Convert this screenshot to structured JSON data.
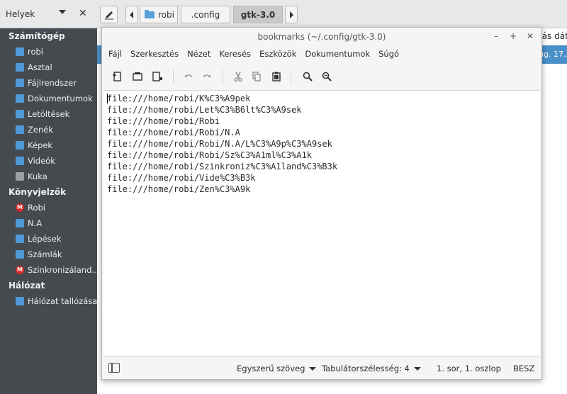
{
  "file_manager": {
    "places_header": {
      "title": "Helyek"
    },
    "breadcrumbs": [
      {
        "label": "robi"
      },
      {
        "label": ".config"
      },
      {
        "label": "gtk-3.0"
      }
    ],
    "column_header_fragment": "tás dát",
    "selected_row_date_fragment": "ug. 17.,",
    "sidebar": {
      "sections": [
        {
          "title": "Számítógép",
          "items": [
            {
              "label": "robi",
              "icon": "home-folder-icon"
            },
            {
              "label": "Asztal",
              "icon": "desktop-folder-icon"
            },
            {
              "label": "Fájlrendszer",
              "icon": "filesystem-icon"
            },
            {
              "label": "Dokumentumok",
              "icon": "documents-folder-icon"
            },
            {
              "label": "Letöltések",
              "icon": "downloads-folder-icon"
            },
            {
              "label": "Zenék",
              "icon": "music-folder-icon"
            },
            {
              "label": "Képek",
              "icon": "pictures-folder-icon"
            },
            {
              "label": "Videók",
              "icon": "videos-folder-icon"
            },
            {
              "label": "Kuka",
              "icon": "trash-icon"
            }
          ]
        },
        {
          "title": "Könyvjelzők",
          "items": [
            {
              "label": "Robi",
              "icon": "mega-icon"
            },
            {
              "label": "N.A",
              "icon": "folder-icon"
            },
            {
              "label": "Lépések",
              "icon": "folder-icon"
            },
            {
              "label": "Számlák",
              "icon": "folder-icon"
            },
            {
              "label": "Szinkronizáland…",
              "icon": "mega-icon"
            }
          ]
        },
        {
          "title": "Hálózat",
          "items": [
            {
              "label": "Hálózat tallózása",
              "icon": "network-icon"
            }
          ]
        }
      ]
    }
  },
  "gedit": {
    "title": "bookmarks (~/.config/gtk-3.0)",
    "menu": [
      "Fájl",
      "Szerkesztés",
      "Nézet",
      "Keresés",
      "Eszközök",
      "Dokumentumok",
      "Súgó"
    ],
    "lines": [
      "file:///home/robi/K%C3%A9pek",
      "file:///home/robi/Let%C3%B6lt%C3%A9sek",
      "file:///home/robi/Robi",
      "file:///home/robi/Robi/N.A",
      "file:///home/robi/Robi/N.A/L%C3%A9p%C3%A9sek",
      "file:///home/robi/Robi/Sz%C3%A1ml%C3%A1k",
      "file:///home/robi/Szinkroniz%C3%A1land%C3%B3k",
      "file:///home/robi/Vide%C3%B3k",
      "file:///home/robi/Zen%C3%A9k"
    ],
    "status": {
      "language": "Egyszerű szöveg",
      "tab_width_label": "Tabulátorszélesség: 4",
      "cursor_position": "1. sor, 1. oszlop",
      "insert_mode": "BESZ"
    }
  },
  "colors": {
    "sidebar_bg": "#454a4f",
    "selection": "#4a90c8",
    "mega_red": "#d42a2a",
    "folder_blue": "#4f9ad6"
  }
}
